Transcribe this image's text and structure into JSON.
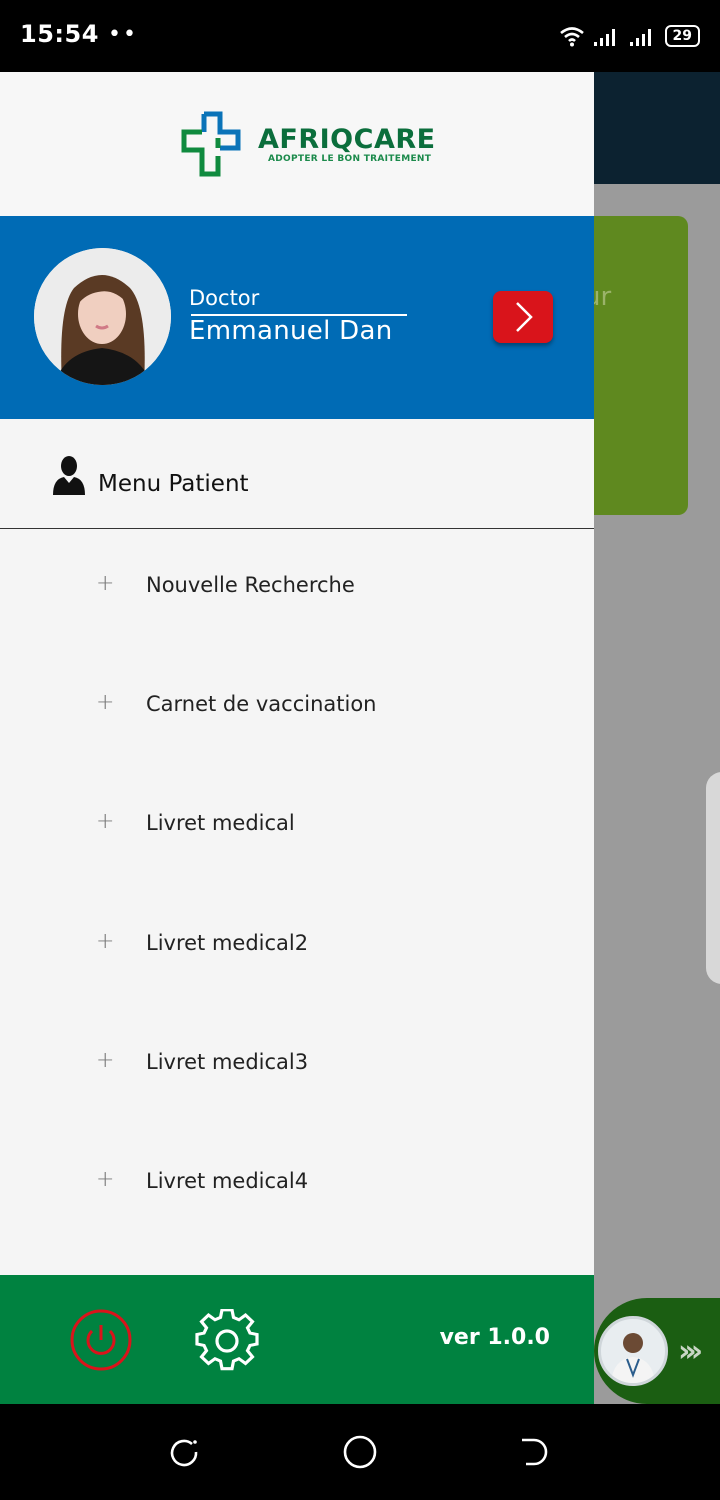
{
  "status_bar": {
    "time": "15:54",
    "dots": "••",
    "battery": "29"
  },
  "background": {
    "card_partial_text": "ur"
  },
  "brand": {
    "name": "AFRIQCARE",
    "tagline": "ADOPTER LE BON TRAITEMENT"
  },
  "profile": {
    "role": "Doctor",
    "name": "Emmanuel Dan"
  },
  "menu": {
    "header": "Menu Patient",
    "items": [
      {
        "label": "Nouvelle Recherche",
        "icon": "plus-icon"
      },
      {
        "label": "Carnet de vaccination",
        "icon": "plus-icon"
      },
      {
        "label": "Livret medical",
        "icon": "plus-icon"
      },
      {
        "label": "Livret medical2",
        "icon": "plus-icon"
      },
      {
        "label": "Livret medical3",
        "icon": "plus-icon"
      },
      {
        "label": "Livret medical4",
        "icon": "plus-icon"
      }
    ]
  },
  "footer": {
    "version": "ver 1.0.0"
  },
  "colors": {
    "profile_bg": "#006bb5",
    "footer_bg": "#008240",
    "go_button": "#d9141b",
    "power_icon": "#d9141b",
    "brand_green": "#0b6e3c",
    "brand_blue": "#0a73b8"
  }
}
